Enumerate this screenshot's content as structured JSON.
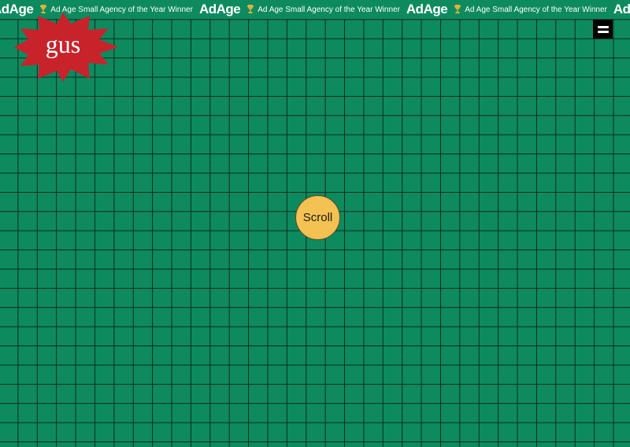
{
  "ticker": {
    "items": [
      {
        "logo": "AdAge",
        "text": "Ad Age Small Agency of the Year Winner"
      },
      {
        "logo": "AdAge",
        "text": "Ad Age Small Agency of the Year Winner"
      },
      {
        "logo": "AdAge",
        "text": "Ad Age Small Agency of the Year Winner"
      },
      {
        "logo": "AdAge",
        "text": ""
      }
    ],
    "trophy_icon": "trophy-icon"
  },
  "brand": {
    "logo_text": "gus",
    "starburst_color": "#c8232b"
  },
  "menu": {
    "icon": "hamburger-menu-icon"
  },
  "scroll_button": {
    "label": "Scroll",
    "color": "#f4c153"
  },
  "colors": {
    "background": "#0e8a5f",
    "grid_lines": "#0a2819"
  }
}
